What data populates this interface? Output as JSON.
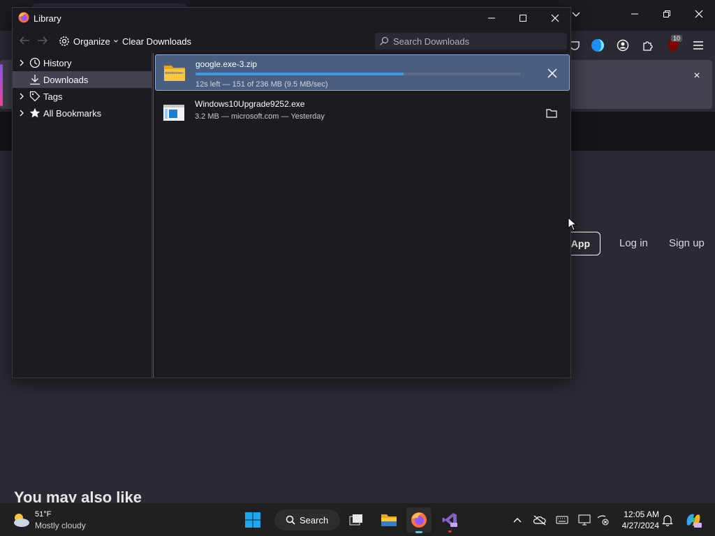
{
  "background": {
    "app_button": "App",
    "login": "Log in",
    "signup": "Sign up",
    "heading": "You may also like",
    "notification_close": "×",
    "extension_badge": "10"
  },
  "library": {
    "title": "Library",
    "toolbar": {
      "organize": "Organize",
      "clear_downloads": "Clear Downloads",
      "search_placeholder": "Search Downloads"
    },
    "sidebar": [
      {
        "label": "History",
        "icon": "clock-icon",
        "expandable": true
      },
      {
        "label": "Downloads",
        "icon": "download-icon",
        "expandable": false,
        "selected": true
      },
      {
        "label": "Tags",
        "icon": "tag-icon",
        "expandable": true
      },
      {
        "label": "All Bookmarks",
        "icon": "star-icon",
        "expandable": true
      }
    ],
    "downloads": [
      {
        "name": "google.exe-3.zip",
        "status": "12s left — 151 of 236 MB (9.5 MB/sec)",
        "progress": 0.64,
        "action": "cancel",
        "icon": "zip-folder-icon"
      },
      {
        "name": "Windows10Upgrade9252.exe",
        "status": "3.2 MB — microsoft.com — Yesterday",
        "action": "open-folder",
        "icon": "exe-file-icon"
      }
    ]
  },
  "taskbar": {
    "weather": {
      "temp": "51°F",
      "desc": "Mostly cloudy"
    },
    "search_label": "Search",
    "clock": {
      "time": "12:05 AM",
      "date": "4/27/2024"
    },
    "colors": {
      "accent": "#4cc2ff",
      "progress": "#3d9ae8"
    }
  }
}
